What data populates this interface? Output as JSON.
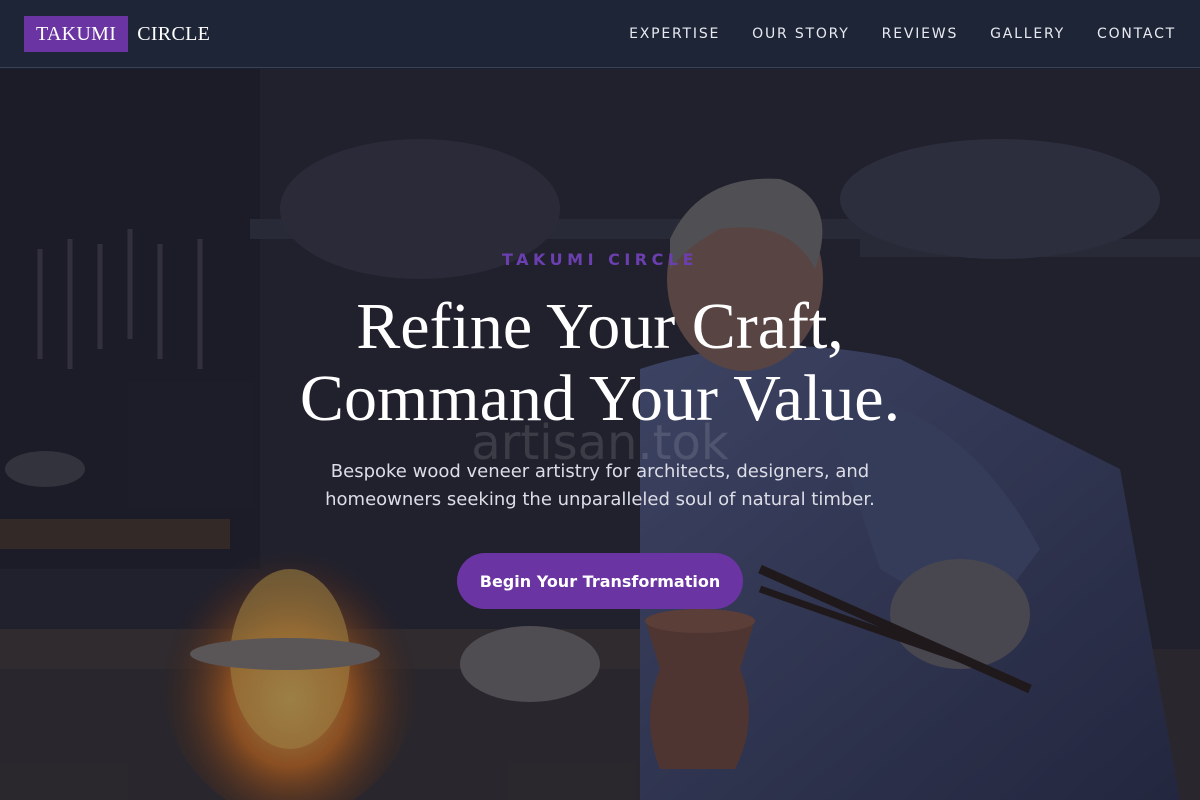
{
  "nav": {
    "logo_box": "TAKUMI",
    "logo_rest": "CIRCLE",
    "links": [
      "EXPERTISE",
      "OUR STORY",
      "REVIEWS",
      "GALLERY",
      "CONTACT"
    ]
  },
  "hero": {
    "eyebrow": "TAKUMI CIRCLE",
    "headline_line1": "Refine Your Craft,",
    "headline_line2": "Command Your Value.",
    "subtitle": "Bespoke wood veneer artistry for architects, designers, and homeowners seeking the unparalleled soul of natural timber.",
    "cta_label": "Begin Your Transformation",
    "watermark": "artisan.tok"
  },
  "colors": {
    "accent": "#6b34a3",
    "nav_bg": "#1e2537"
  }
}
